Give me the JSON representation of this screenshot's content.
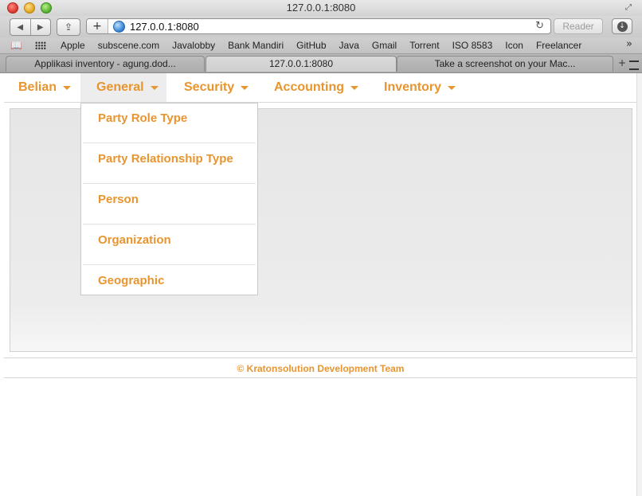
{
  "window": {
    "title": "127.0.0.1:8080"
  },
  "toolbar": {
    "url": "127.0.0.1:8080",
    "reader_label": "Reader",
    "icons": {
      "back": "back-arrow-icon",
      "forward": "forward-arrow-icon",
      "share": "share-icon",
      "add": "plus-icon",
      "reload": "reload-icon",
      "download": "download-icon"
    }
  },
  "bookmarks": {
    "items": [
      "Apple",
      "subscene.com",
      "Javalobby",
      "Bank Mandiri",
      "GitHub",
      "Java",
      "Gmail",
      "Torrent",
      "ISO 8583",
      "Icon",
      "Freelancer"
    ],
    "more_label": "»"
  },
  "tabs": [
    {
      "label": "Applikasi inventory - agung.dod..."
    },
    {
      "label": "127.0.0.1:8080",
      "active": true
    },
    {
      "label": "Take a screenshot on your Mac..."
    }
  ],
  "nav": {
    "items": [
      {
        "label": "Belian"
      },
      {
        "label": "General",
        "open": true
      },
      {
        "label": "Security"
      },
      {
        "label": "Accounting"
      },
      {
        "label": "Inventory"
      }
    ]
  },
  "general_menu": {
    "items": [
      {
        "label": "Party Role Type"
      },
      {
        "label": "Party Relationship Type"
      },
      {
        "label": "Person"
      },
      {
        "label": "Organization"
      },
      {
        "label": "Geographic"
      }
    ]
  },
  "footer": {
    "text": "© Kratonsolution Development Team"
  },
  "colors": {
    "accent": "#e8952f",
    "nav_open_bg": "#ededed",
    "content_bg": "#e6e6e6"
  }
}
